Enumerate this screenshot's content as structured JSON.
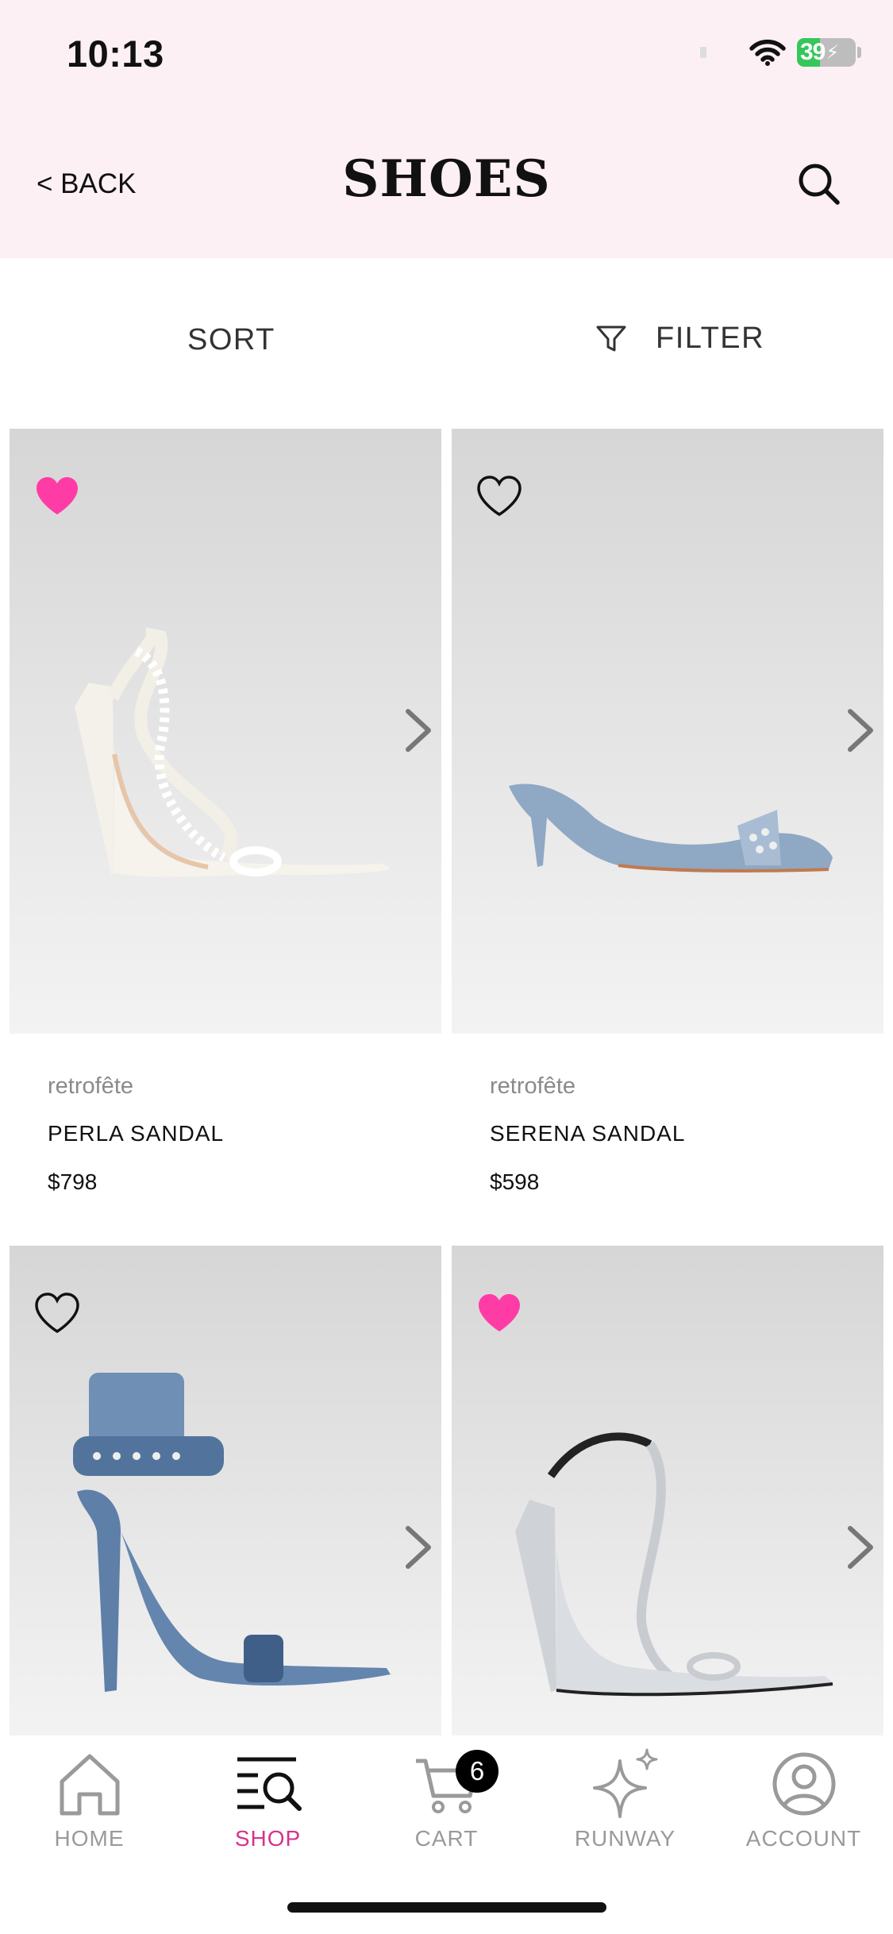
{
  "status": {
    "time": "10:13",
    "battery": "39"
  },
  "header": {
    "back_label": "< BACK",
    "title": "SHOES"
  },
  "controls": {
    "sort_label": "SORT",
    "filter_label": "FILTER"
  },
  "products": [
    {
      "brand": "retrofête",
      "name": "PERLA SANDAL",
      "price": "$798",
      "favorited": true
    },
    {
      "brand": "retrofête",
      "name": "SERENA SANDAL",
      "price": "$598",
      "favorited": false
    },
    {
      "brand": "",
      "name": "",
      "price": "",
      "favorited": false
    },
    {
      "brand": "",
      "name": "",
      "price": "",
      "favorited": true
    }
  ],
  "nav": {
    "home": "HOME",
    "shop": "SHOP",
    "cart": "CART",
    "cart_count": "6",
    "runway": "RUNWAY",
    "account": "ACCOUNT"
  },
  "colors": {
    "header_bg": "#fdf0f5",
    "accent_pink": "#ff3ca6",
    "active_nav": "#d6338a",
    "battery_green": "#35c759"
  },
  "icons": [
    "wifi-icon",
    "battery-icon",
    "search-icon",
    "filter-icon",
    "heart-icon",
    "chevron-right-icon",
    "home-icon",
    "shop-icon",
    "cart-icon",
    "runway-icon",
    "account-icon"
  ]
}
